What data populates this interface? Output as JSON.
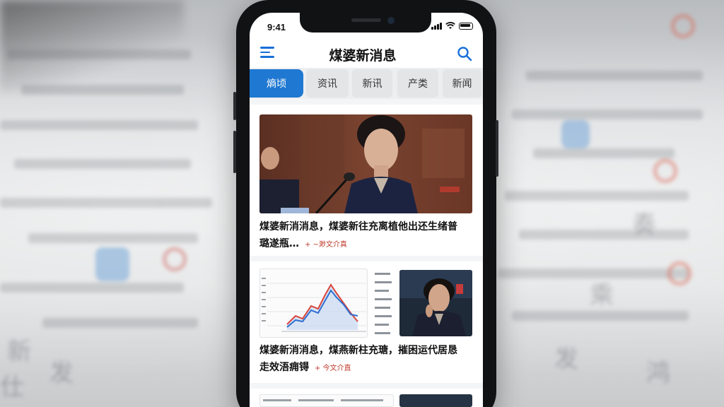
{
  "status_bar": {
    "time": "9:41"
  },
  "header": {
    "title": "煤婆新消息"
  },
  "tabs": [
    {
      "label": "熵顷",
      "active": true
    },
    {
      "label": "资讯",
      "active": false
    },
    {
      "label": "新讯",
      "active": false
    },
    {
      "label": "产类",
      "active": false
    },
    {
      "label": "新闻",
      "active": false
    }
  ],
  "feed": [
    {
      "headline_line1": "煤婆新消消息，煤婆新往充离植他出还生绪普",
      "headline_line2": "璐遂瓶…",
      "meta": "+ ~渺文介真"
    },
    {
      "headline_line1": "煤婆新消消息，煤燕新柱充瑭，摧困运代居恳",
      "headline_line2": "走效浯痈锝",
      "meta": "+ 今文介直"
    }
  ],
  "colors": {
    "accent": "#1f78d1",
    "meta_red": "#c0392b",
    "chart_red": "#d9443a",
    "chart_blue": "#2f6fd0"
  },
  "icons": [
    "menu-icon",
    "search-icon",
    "signal-icon",
    "wifi-icon",
    "battery-icon"
  ]
}
